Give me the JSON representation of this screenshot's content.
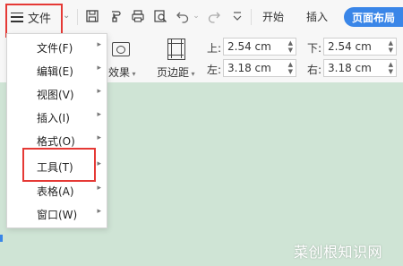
{
  "toolbar": {
    "file_label": "文件",
    "tabs": [
      "开始",
      "插入"
    ],
    "active_tab": "页面布局",
    "icons": [
      "save-icon",
      "format-painter-icon",
      "print-icon",
      "print-preview-icon",
      "undo-icon",
      "redo-icon",
      "customize-icon"
    ]
  },
  "menu": {
    "items": [
      {
        "label": "文件(F)"
      },
      {
        "label": "编辑(E)"
      },
      {
        "label": "视图(V)"
      },
      {
        "label": "插入(I)"
      },
      {
        "label": "格式(O)"
      },
      {
        "label": "工具(T)"
      },
      {
        "label": "表格(A)"
      },
      {
        "label": "窗口(W)"
      }
    ],
    "highlighted_item": "工具(T)"
  },
  "ribbon": {
    "effects_label": "效果",
    "margins_label": "页边距",
    "top_label": "上:",
    "top_value": "2.54 cm",
    "bottom_label": "下:",
    "bottom_value": "2.54 cm",
    "left_label": "左:",
    "left_value": "3.18 cm",
    "right_label": "右:",
    "right_value": "3.18 cm"
  },
  "watermark": "菜创根知识网",
  "colors": {
    "accent": "#3a86e8",
    "highlight_border": "#e53935",
    "document_bg": "#cfe4d5"
  }
}
